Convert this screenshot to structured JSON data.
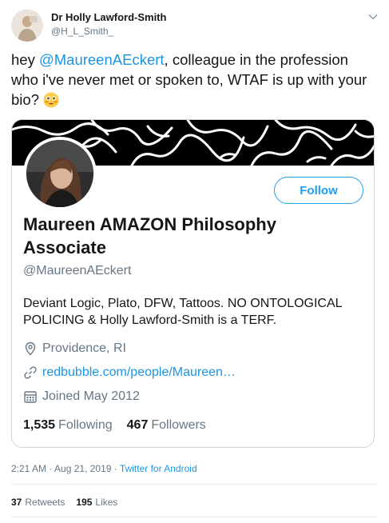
{
  "author": {
    "name": "Dr Holly Lawford-Smith",
    "handle": "@H_L_Smith_"
  },
  "tweet": {
    "text_before": "hey ",
    "mention": "@MaureenAEckert",
    "text_after": ", colleague in the profession who i've never met or spoken to, WTAF is up with your bio? ",
    "emoji": "flushed-face-emoji"
  },
  "profile_card": {
    "name": "Maureen AMAZON Philosophy Associate",
    "handle": "@MaureenAEckert",
    "follow_label": "Follow",
    "bio": "Deviant Logic, Plato, DFW, Tattoos.  NO ONTOLOGICAL POLICING & Holly Lawford-Smith is a TERF.",
    "location": "Providence, RI",
    "website": "redbubble.com/people/Maureen…",
    "joined": "Joined May 2012",
    "following_count": "1,535",
    "following_label": "Following",
    "followers_count": "467",
    "followers_label": "Followers"
  },
  "meta": {
    "time": "2:21 AM",
    "sep1": " · ",
    "date": "Aug 21, 2019",
    "sep2": " · ",
    "source": "Twitter for Android"
  },
  "engagement": {
    "retweets_count": "37",
    "retweets_label": "Retweets",
    "likes_count": "195",
    "likes_label": "Likes"
  },
  "icons": [
    "chevron-down-icon",
    "location-pin-icon",
    "link-icon",
    "calendar-icon"
  ],
  "colors": {
    "accent": "#1da1f2",
    "link": "#1b95e0",
    "muted": "#657786",
    "text": "#14171a"
  }
}
